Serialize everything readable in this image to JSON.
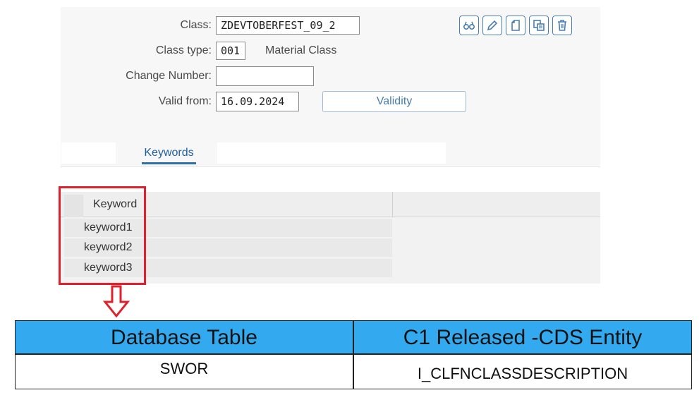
{
  "form": {
    "class_label": "Class:",
    "class_value": "ZDEVTOBERFEST_09_2",
    "class_type_label": "Class type:",
    "class_type_value": "001",
    "class_type_desc": "Material Class",
    "change_number_label": "Change Number:",
    "change_number_value": "",
    "valid_from_label": "Valid from:",
    "valid_from_value": "16.09.2024",
    "validity_button": "Validity"
  },
  "toolbar": {
    "icons": [
      "display-icon",
      "edit-icon",
      "create-icon",
      "copy-icon",
      "delete-icon"
    ]
  },
  "tabs": {
    "active": "Keywords"
  },
  "keywords_table": {
    "header": "Keyword",
    "rows": [
      "keyword1",
      "keyword2",
      "keyword3"
    ]
  },
  "annotation": {
    "highlight_color": "#e0202a",
    "arrow_color": "#e0202a"
  },
  "mapping_table": {
    "headers": [
      "Database Table",
      "C1 Released -CDS Entity"
    ],
    "values": [
      "SWOR",
      "I_CLFNCLASSDESCRIPTION"
    ],
    "header_color": "#33aaef"
  }
}
